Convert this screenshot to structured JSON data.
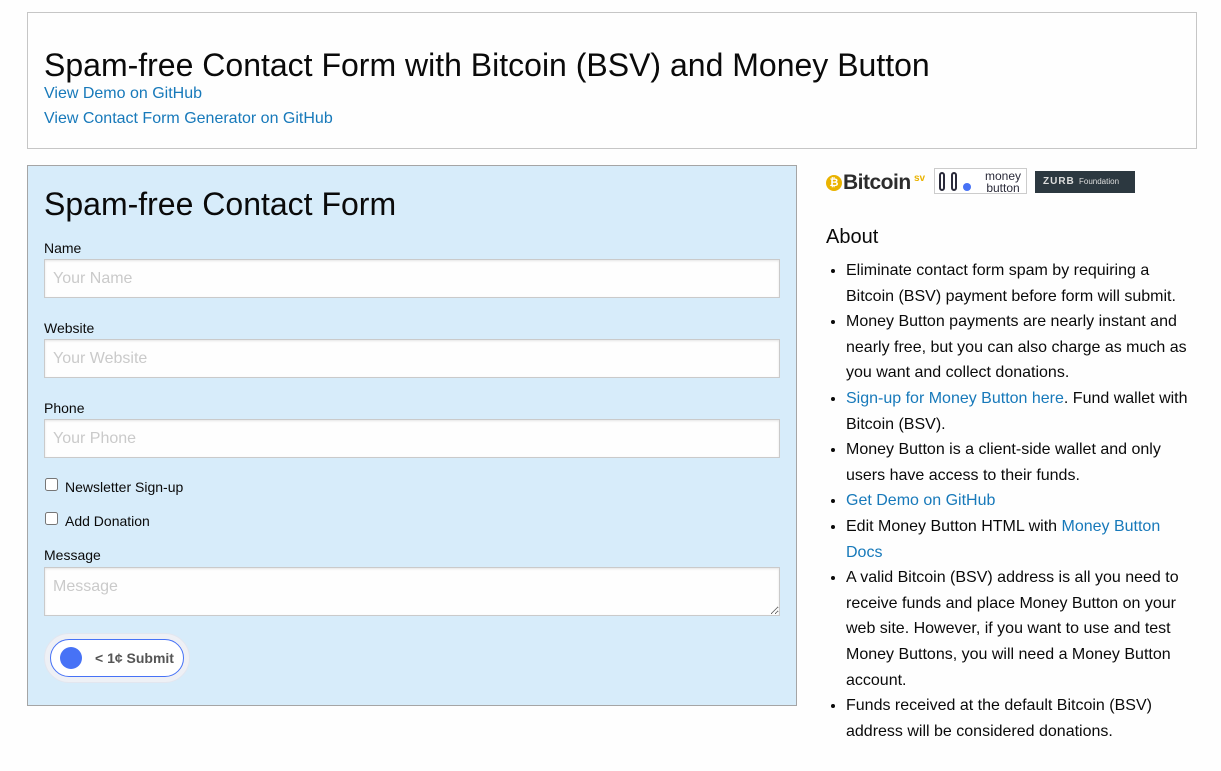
{
  "header": {
    "title": "Spam-free Contact Form with Bitcoin (BSV) and Money Button",
    "link_demo": "View Demo on GitHub",
    "link_generator": "View Contact Form Generator on GitHub"
  },
  "form": {
    "title": "Spam-free Contact Form",
    "name_label": "Name",
    "name_placeholder": "Your Name",
    "website_label": "Website",
    "website_placeholder": "Your Website",
    "phone_label": "Phone",
    "phone_placeholder": "Your Phone",
    "newsletter_label": "Newsletter Sign-up",
    "newsletter_checked": false,
    "donation_label": "Add Donation",
    "donation_checked": false,
    "message_label": "Message",
    "message_placeholder": "Message",
    "submit_label": "< 1¢ Submit"
  },
  "logos": {
    "bitcoin_word": "Bitcoin",
    "bitcoin_sv": "sv",
    "bitcoin_symbol": "₿",
    "moneybutton_line1": "money",
    "moneybutton_line2": "button",
    "zurb_mark": "ZURB",
    "zurb_foundation": "Foundation"
  },
  "about": {
    "title": "About",
    "item1": "Eliminate contact form spam by requiring a Bitcoin (BSV) payment before form will submit.",
    "item2": "Money Button payments are nearly instant and nearly free, but you can also charge as much as you want and collect donations.",
    "item3_link": "Sign-up for Money Button here",
    "item3_text": ". Fund wallet with Bitcoin (BSV).",
    "item4": "Money Button is a client-side wallet and only users have access to their funds.",
    "item5_link": "Get Demo on GitHub",
    "item6_text": "Edit Money Button HTML with ",
    "item6_link": "Money Button Docs",
    "item7": "A valid Bitcoin (BSV) address is all you need to receive funds and place Money Button on your web site. However, if you want to use and test Money Buttons, you will need a Money Button account.",
    "item8": "Funds received at the default Bitcoin (BSV) address will be considered donations."
  },
  "colors": {
    "link": "#1779ba",
    "form_bg": "#d7ecfa",
    "moneybutton_blue": "#4772f6"
  }
}
